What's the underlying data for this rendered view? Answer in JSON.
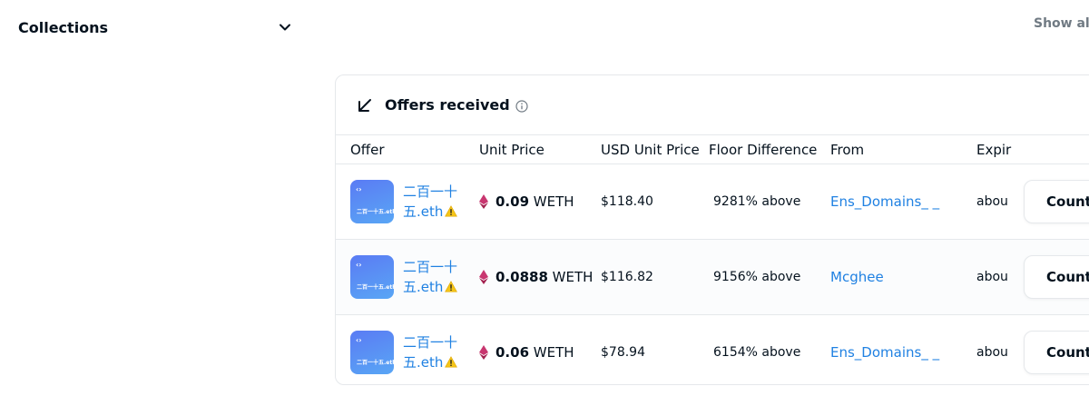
{
  "sidebar": {
    "collections_label": "Collections"
  },
  "header": {
    "show_all": "Show all"
  },
  "offers": {
    "title": "Offers received",
    "columns": [
      "Offer",
      "Unit Price",
      "USD Unit Price",
      "Floor Difference",
      "From",
      "Expir"
    ],
    "rows": [
      {
        "thumb_label": "二百一十五.eth",
        "name_line1": "二百一十",
        "name_line2": "五.eth",
        "amount": "0.09",
        "currency": "WETH",
        "usd": "$118.40",
        "floor": "9281% above",
        "from": "Ens_Domains_ _",
        "expiration": "abou",
        "action": "Count"
      },
      {
        "thumb_label": "二百一十五.eth",
        "name_line1": "二百一十",
        "name_line2": "五.eth",
        "amount": "0.0888",
        "currency": "WETH",
        "usd": "$116.82",
        "floor": "9156% above",
        "from": "Mcghee",
        "expiration": "abou",
        "action": "Count"
      },
      {
        "thumb_label": "二百一十五.eth",
        "name_line1": "二百一十",
        "name_line2": "五.eth",
        "amount": "0.06",
        "currency": "WETH",
        "usd": "$78.94",
        "floor": "6154% above",
        "from": "Ens_Domains_ _",
        "expiration": "abou",
        "action": "Count"
      }
    ]
  },
  "colors": {
    "link": "#2081e2",
    "text": "#04111d",
    "muted": "#707a83",
    "border": "#e5e8eb",
    "eth": "#c8366f"
  },
  "icons": {
    "chevron": "chevron-down-icon",
    "arrow": "arrow-down-left-icon",
    "info": "info-icon",
    "eth": "eth-icon",
    "warning": "warning-icon"
  }
}
